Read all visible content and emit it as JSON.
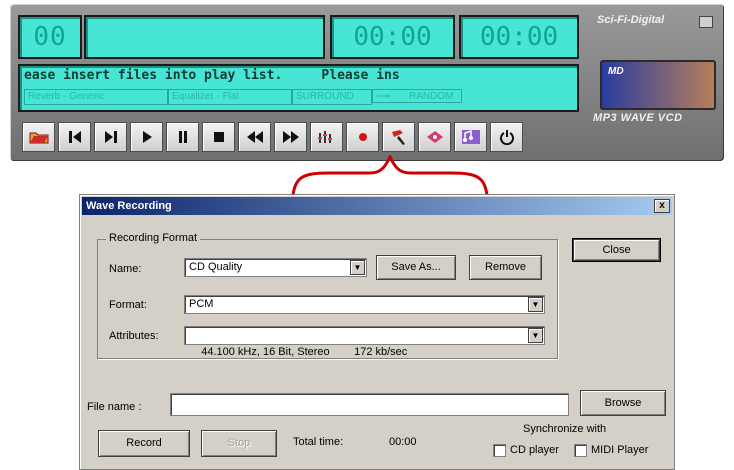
{
  "player": {
    "track_number": "00",
    "elapsed_time": "00:00",
    "remaining_time": "00:00",
    "message": "ease insert files into play list.     Please ins",
    "modes": {
      "reverb": "Reverb - Generic",
      "equalizer": "Equalizer - Flat",
      "surround": "SURROUND",
      "random": "RANDOM"
    },
    "brand": "Sci-Fi-Digital",
    "logo_text": "MD",
    "formats": "MP3 WAVE VCD",
    "toolbar": [
      {
        "name": "open-folder-icon"
      },
      {
        "name": "previous-track-icon"
      },
      {
        "name": "next-track-icon"
      },
      {
        "name": "play-icon"
      },
      {
        "name": "pause-icon"
      },
      {
        "name": "stop-icon"
      },
      {
        "name": "rewind-icon"
      },
      {
        "name": "fast-forward-icon"
      },
      {
        "name": "equalizer-icon"
      },
      {
        "name": "record-icon"
      },
      {
        "name": "tools-icon"
      },
      {
        "name": "disc-icon"
      },
      {
        "name": "playlist-icon"
      },
      {
        "name": "power-icon"
      }
    ]
  },
  "dialog": {
    "title": "Wave Recording",
    "close_x": "x",
    "group_label": "Recording Format",
    "name_label": "Name:",
    "name_value": "CD Quality",
    "save_as_label": "Save As...",
    "remove_label": "Remove",
    "close_label": "Close",
    "format_label": "Format:",
    "format_value": "PCM",
    "attributes_label": "Attributes:",
    "attributes_value": "44.100 kHz, 16 Bit, Stereo        172 kb/sec",
    "file_name_label": "File name :",
    "file_name_value": "",
    "browse_label": "Browse",
    "record_label": "Record",
    "stop_label": "Stop",
    "total_time_label": "Total time:",
    "total_time_value": "00:00",
    "sync_label": "Synchronize with",
    "cd_player_label": "CD player",
    "midi_player_label": "MIDI Player"
  },
  "colors": {
    "lcd": "#47e5d4",
    "accent_red": "#cc0000",
    "titlebar": "#0a246a"
  }
}
